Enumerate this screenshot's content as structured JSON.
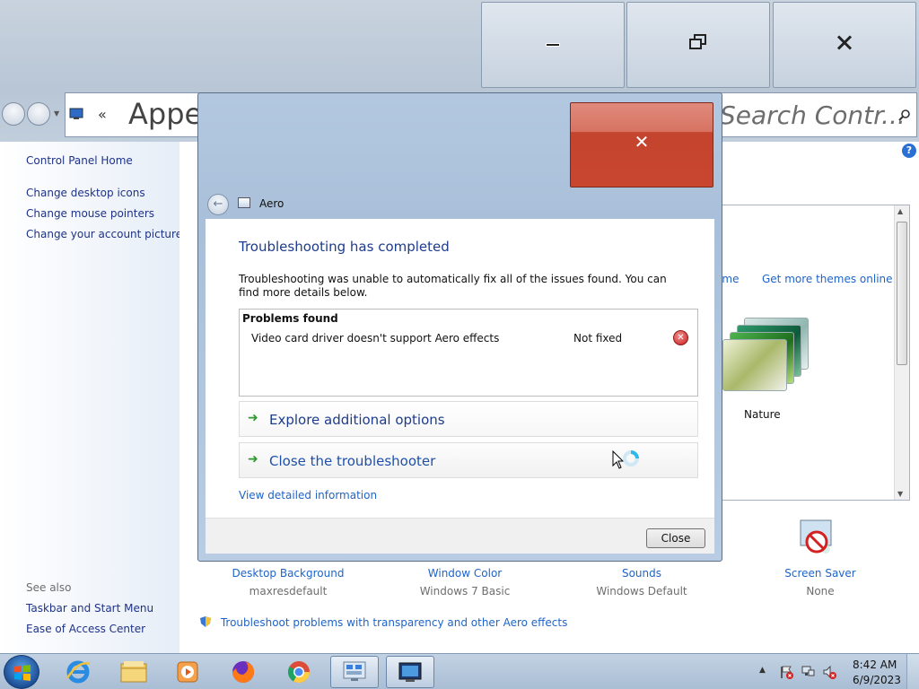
{
  "window": {
    "address_path": "Appe",
    "address_chevron": "«",
    "search_placeholder": "Search Contr..."
  },
  "sidebar": {
    "items": [
      {
        "label": "Control Panel Home"
      },
      {
        "label": "Change desktop icons"
      },
      {
        "label": "Change mouse pointers"
      },
      {
        "label": "Change your account picture"
      }
    ],
    "see_also_label": "See also",
    "see_also_items": [
      {
        "label": "Taskbar and Start Menu"
      },
      {
        "label": "Ease of Access Center"
      }
    ]
  },
  "themes": {
    "link_partial": "eme",
    "link_online": "Get more themes online",
    "nature_label": "Nature"
  },
  "bottom_items": [
    {
      "title": "Desktop Background",
      "sub": "maxresdefault"
    },
    {
      "title": "Window Color",
      "sub": "Windows 7 Basic"
    },
    {
      "title": "Sounds",
      "sub": "Windows Default"
    },
    {
      "title": "Screen Saver",
      "sub": "None"
    }
  ],
  "troubleshoot_link": "Troubleshoot problems with transparency and other Aero effects",
  "dialog": {
    "app_label": "Aero",
    "heading": "Troubleshooting has completed",
    "description": "Troubleshooting was unable to automatically fix all of the issues found. You can find more details below.",
    "problems_title": "Problems found",
    "problem_name": "Video card driver doesn't support Aero effects",
    "problem_status": "Not fixed",
    "action_explore": "Explore additional options",
    "action_close": "Close the troubleshooter",
    "view_details": "View detailed information",
    "close_button": "Close"
  },
  "taskbar": {
    "time": "8:42 AM",
    "date": "6/9/2023"
  },
  "colors": {
    "link_blue": "#1e64c8",
    "heading_blue": "#1e3c8c",
    "close_red": "#c4442e",
    "arrow_green": "#2e9a2e"
  }
}
